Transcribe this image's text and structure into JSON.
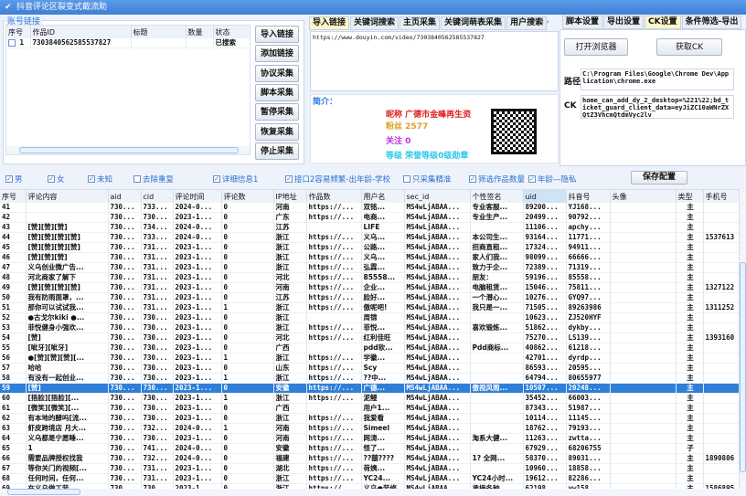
{
  "window": {
    "title": "抖音评论区裂变式截流助"
  },
  "account_group": {
    "label": "账号链接",
    "columns": [
      "序号",
      "作品ID",
      "标题",
      "数量",
      "状态"
    ],
    "rows": [
      {
        "no": "1",
        "id": "7303840562585537827",
        "title": "",
        "count": "",
        "status": "已搜索"
      }
    ]
  },
  "side_buttons": [
    "导入链接",
    "添加链接",
    "协议采集",
    "脚本采集",
    "暂停采集",
    "恢复采集",
    "停止采集"
  ],
  "middle_tabs": [
    "导入链接",
    "关键词搜索",
    "主页采集",
    "关键词萌表采集",
    "用户搜索"
  ],
  "link_text": "https://www.douyin.com/video/7303840562585537827",
  "profile": {
    "label": "简介：",
    "nickname_label": "昵称",
    "nickname": "广德市金峰再生资",
    "fans_label": "粉丝",
    "fans": "2577",
    "follow_label": "关注",
    "follow": "0",
    "level_label": "等级",
    "level": "荣誉等级0级勋章"
  },
  "right_tabs": [
    "脚本设置",
    "导出设置",
    "CK设置",
    "条件筛选-导出"
  ],
  "ck": {
    "open_browser": "打开浏览器",
    "get_ck": "获取CK",
    "path_label": "路径",
    "path": "C:\\Program Files\\Google\\Chrome Dev\\Application\\chrome.exe",
    "ck_label": "CK",
    "ck_value": "home_can_add_dy_2_desktop=%221%22;bd_ticket_guard_client_data=eyJiZC10aWNrZXQtZ3VhcmQtdmVyc2lv"
  },
  "options": [
    {
      "label": "男",
      "checked": true
    },
    {
      "label": "女",
      "checked": true
    },
    {
      "label": "未知",
      "checked": true
    },
    {
      "label": "去除重复",
      "checked": false
    },
    {
      "label": "详细信息1",
      "checked": true
    },
    {
      "label": "接口2容易频繁-出年龄-学校",
      "checked": true
    },
    {
      "label": "只采集精准",
      "checked": false
    },
    {
      "label": "筛选作品数量",
      "checked": true
    },
    {
      "label": "年龄—隐私",
      "checked": true
    }
  ],
  "save_config": "保存配置",
  "results": {
    "columns": [
      "序号",
      "评论内容",
      "aid",
      "cid",
      "评论时间",
      "评论数",
      "IP地址",
      "作品数",
      "用户名",
      "sec_id",
      "个性签名",
      "uid",
      "抖音号",
      "头像",
      "类型",
      "手机号"
    ],
    "selected": "59",
    "rows": [
      [
        "41",
        "",
        "730...",
        "733...",
        "2024-0...",
        "0",
        "河南",
        "https://...",
        "双铭...",
        "MS4wLjABAA...",
        "专业客服...",
        "89200...",
        "YJ168...",
        "",
        "主",
        ""
      ],
      [
        "42",
        "",
        "730...",
        "730...",
        "2023-1...",
        "0",
        "广东",
        "https://...",
        "电商...",
        "MS4wLjABAA...",
        "专业生产...",
        "20499...",
        "90792...",
        "",
        "主",
        ""
      ],
      [
        "43",
        "[赞][赞][赞]",
        "730...",
        "734...",
        "2024-0...",
        "0",
        "江苏",
        "",
        "LIFE",
        "MS4wLjABAA...",
        "",
        "11106...",
        "apchy...",
        "",
        "主",
        ""
      ],
      [
        "44",
        "[赞][赞][赞][赞]",
        "730...",
        "733...",
        "2024-0...",
        "0",
        "浙江",
        "https://...",
        "义乌...",
        "MS4wLjABAA...",
        "本公司生...",
        "93164...",
        "11771...",
        "",
        "主",
        "1537613"
      ],
      [
        "45",
        "[赞][赞][赞][赞]",
        "730...",
        "731...",
        "2023-1...",
        "0",
        "浙江",
        "https://...",
        "公路...",
        "MS4wLjABAA...",
        "招商直租...",
        "17324...",
        "94911...",
        "",
        "主",
        ""
      ],
      [
        "46",
        "[赞][赞][赞]",
        "730...",
        "731...",
        "2023-1...",
        "0",
        "浙江",
        "https://...",
        "义乌...",
        "MS4wLjABAA...",
        "家人们我...",
        "98099...",
        "66666...",
        "",
        "主",
        ""
      ],
      [
        "47",
        "义乌创业微广告...",
        "730...",
        "731...",
        "2023-1...",
        "0",
        "浙江",
        "https://...",
        "弘霖...",
        "MS4wLjABAA...",
        "致力于企...",
        "72389...",
        "71319...",
        "",
        "主",
        ""
      ],
      [
        "48",
        "河北商家了解下",
        "730...",
        "731...",
        "2023-1...",
        "0",
        "河北",
        "https://...",
        "85558...",
        "MS4wLjABAA...",
        "朋友：",
        "59196...",
        "85558...",
        "",
        "主",
        ""
      ],
      [
        "49",
        "[赞][赞][赞][赞]",
        "730...",
        "731...",
        "2023-1...",
        "0",
        "河南",
        "https://...",
        "企业...",
        "MS4wLjABAA...",
        "电脑租赁...",
        "15046...",
        "75811...",
        "",
        "主",
        "1327122"
      ],
      [
        "50",
        "我有防雨面罩，...",
        "730...",
        "731...",
        "2023-1...",
        "0",
        "江苏",
        "https://...",
        "脸好...",
        "MS4wLjABAA...",
        "一个潜心...",
        "10276...",
        "GYQ97...",
        "",
        "主",
        ""
      ],
      [
        "51",
        "那你可以试试我...",
        "730...",
        "731...",
        "2023-1...",
        "1",
        "浙江",
        "https://...",
        "傲呢吧!",
        "MS4wLjABAA...",
        "我只是一...",
        "71505...",
        "89263986",
        "",
        "主",
        "1311252"
      ],
      [
        "52",
        "●古戈尔kiki ●...",
        "730...",
        "730...",
        "2023-1...",
        "0",
        "浙江",
        "",
        "周锦",
        "MS4wLjABAA...",
        "",
        "10623...",
        "ZJ520HYF",
        "",
        "主",
        ""
      ],
      [
        "53",
        "菲悦健身小强欢...",
        "730...",
        "730...",
        "2023-1...",
        "0",
        "浙江",
        "https://...",
        "菲悦...",
        "MS4wLjABAA...",
        "喜欢锻炼...",
        "51862...",
        "dykby...",
        "",
        "主",
        ""
      ],
      [
        "54",
        "[赞]",
        "730...",
        "730...",
        "2023-1...",
        "0",
        "河北",
        "https://...",
        "红利佳旺",
        "MS4wLjABAA...",
        "",
        "75270...",
        "LS139...",
        "",
        "主",
        "1393160"
      ],
      [
        "55",
        "[呲牙][呲牙]",
        "730...",
        "730...",
        "2023-1...",
        "0",
        "广西",
        "",
        "pdd软...",
        "MS4wLjABAA...",
        "Pdd商标...",
        "40862...",
        "61218...",
        "",
        "主",
        ""
      ],
      [
        "56",
        "●[赞][赞][赞][...",
        "730...",
        "730...",
        "2023-1...",
        "1",
        "浙江",
        "https://...",
        "学徽...",
        "MS4wLjABAA...",
        "",
        "42701...",
        "dyrdp...",
        "",
        "主",
        ""
      ],
      [
        "57",
        "哈哈",
        "730...",
        "730...",
        "2023-1...",
        "0",
        "山东",
        "https://...",
        "Scy",
        "MS4wLjABAA...",
        "",
        "86593...",
        "20595...",
        "",
        "主",
        ""
      ],
      [
        "58",
        "有没有一起创业...",
        "730...",
        "730...",
        "2023-1...",
        "1",
        "浙江",
        "https://...",
        "??中...",
        "MS4wLjABAA...",
        "",
        "64794...",
        "80655977",
        "",
        "主",
        ""
      ],
      [
        "59",
        "[赞]",
        "730...",
        "730...",
        "2023-1...",
        "0",
        "安徽",
        "https://...",
        "广德...",
        "MS4wLjABAA...",
        "傲视风雨...",
        "10507...",
        "20248...",
        "",
        "主",
        ""
      ],
      [
        "60",
        "[捂脸][捂脸][...",
        "730...",
        "730...",
        "2023-1...",
        "1",
        "浙江",
        "https://...",
        "泥鳗",
        "MS4wLjABAA...",
        "",
        "35452...",
        "66003...",
        "",
        "主",
        ""
      ],
      [
        "61",
        "[微笑][微笑][...",
        "730...",
        "730...",
        "2023-1...",
        "0",
        "广西",
        "",
        "用户1...",
        "MS4wLjABAA...",
        "",
        "87343...",
        "51987...",
        "",
        "主",
        ""
      ],
      [
        "62",
        "有本地的酵吗[流...",
        "730...",
        "730...",
        "2023-1...",
        "0",
        "浙江",
        "https://...",
        "我爱看",
        "MS4wLjABAA...",
        "",
        "10114...",
        "11145...",
        "",
        "主",
        ""
      ],
      [
        "63",
        "虾皮跨境店 月大...",
        "730...",
        "732...",
        "2024-0...",
        "1",
        "河南",
        "https://...",
        "Simeel",
        "MS4wLjABAA...",
        "",
        "18762...",
        "79193...",
        "",
        "主",
        ""
      ],
      [
        "64",
        "义乌都是宁愿睡...",
        "730...",
        "730...",
        "2023-1...",
        "0",
        "河南",
        "https://...",
        "网涛...",
        "MS4wLjABAA...",
        "淘系大健...",
        "11263...",
        "zwtta...",
        "",
        "主",
        ""
      ],
      [
        "65",
        "1",
        "730...",
        "741...",
        "2024-0...",
        "0",
        "安徽",
        "https://...",
        "怪了...",
        "MS4wLjABAA...",
        "",
        "67929...",
        "68206755",
        "",
        "子",
        ""
      ],
      [
        "66",
        "需要品牌授权找我",
        "730...",
        "732...",
        "2024-0...",
        "0",
        "福建",
        "https://...",
        "??囍????",
        "MS4wLjABAA...",
        "1? 全网...",
        "58370...",
        "89031...",
        "",
        "主",
        "1890806"
      ],
      [
        "67",
        "等你关门的视频[...",
        "730...",
        "731...",
        "2023-1...",
        "0",
        "湖北",
        "https://...",
        "荷姨...",
        "MS4wLjABAA...",
        "",
        "10960...",
        "18858...",
        "",
        "主",
        ""
      ],
      [
        "68",
        "任何时间，任何...",
        "730...",
        "731...",
        "2023-1...",
        "0",
        "浙江",
        "https://...",
        "YC24...",
        "MS4wLjABAA...",
        "YC24小时...",
        "19612...",
        "82286...",
        "",
        "主",
        ""
      ],
      [
        "69",
        "在义乌做工装，...",
        "730...",
        "730...",
        "2023-1...",
        "0",
        "浙江",
        "https://...",
        "义乌●装修",
        "MS4wLjABAA...",
        "承接各种...",
        "62198...",
        "yw158...",
        "",
        "主",
        "1586895"
      ]
    ]
  }
}
